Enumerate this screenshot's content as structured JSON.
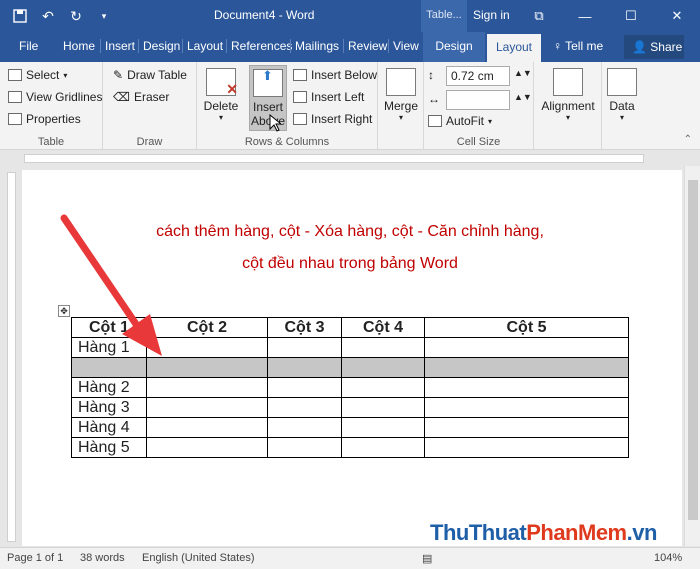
{
  "titlebar": {
    "doc_title": "Document4  -  Word",
    "context_tab": "Table...",
    "signin": "Sign in",
    "quick_access": [
      "save-icon",
      "undo-icon",
      "redo-icon",
      "customize-icon"
    ],
    "window_buttons": [
      "ribbon-display-icon",
      "minimize-icon",
      "maximize-icon",
      "close-icon"
    ]
  },
  "tabs": {
    "items": [
      "File",
      "Home",
      "Insert",
      "Design",
      "Layout",
      "References",
      "Mailings",
      "Review",
      "View"
    ],
    "table_design": "Design",
    "table_layout": "Layout",
    "tellme": "Tell me",
    "share": "Share"
  },
  "ribbon": {
    "table": {
      "select": "Select",
      "view_gridlines": "View Gridlines",
      "properties": "Properties",
      "label": "Table"
    },
    "draw": {
      "draw_table": "Draw Table",
      "eraser": "Eraser",
      "label": "Draw"
    },
    "rows_columns": {
      "delete": "Delete",
      "insert_above_1": "Insert",
      "insert_above_2": "Above",
      "insert_below": "Insert Below",
      "insert_left": "Insert Left",
      "insert_right": "Insert Right",
      "label": "Rows & Columns"
    },
    "merge": {
      "label": "Merge"
    },
    "cell_size": {
      "height": "0.72 cm",
      "width": "",
      "autofit": "AutoFit",
      "label": "Cell Size"
    },
    "alignment": {
      "label": "Alignment"
    },
    "data": {
      "label": "Data"
    }
  },
  "document": {
    "heading_line1": "cách thêm hàng, cột - Xóa hàng, cột - Căn chỉnh hàng,",
    "heading_line2": "cột đều nhau trong bảng Word",
    "table": {
      "headers": [
        "Cột 1",
        "Cột 2",
        "Cột 3",
        "Cột 4",
        "Cột 5"
      ],
      "rows": [
        [
          "Hàng 1",
          "",
          "",
          "",
          ""
        ],
        [
          "",
          "",
          "",
          "",
          ""
        ],
        [
          "Hàng 2",
          "",
          "",
          "",
          ""
        ],
        [
          "Hàng 3",
          "",
          "",
          "",
          ""
        ],
        [
          "Hàng 4",
          "",
          "",
          "",
          ""
        ],
        [
          "Hàng 5",
          "",
          "",
          "",
          ""
        ]
      ]
    }
  },
  "status": {
    "page": "Page 1 of 1",
    "words": "38 words",
    "language": "English (United States)",
    "zoom": "104%"
  },
  "watermark": {
    "part1": "ThuThuat",
    "part2": "PhanMem",
    "part3": ".vn"
  },
  "colors": {
    "word_blue": "#2b579a",
    "heading_red": "#c00000",
    "arrow_red": "#e8383a"
  }
}
